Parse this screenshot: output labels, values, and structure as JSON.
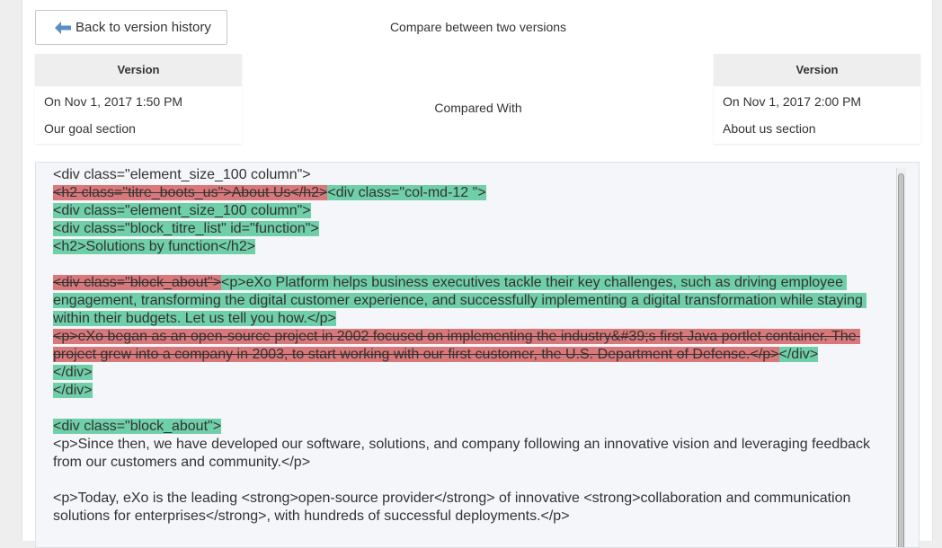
{
  "toolbar": {
    "back_label": "Back to version history"
  },
  "page": {
    "title": "Compare between two versions",
    "compared_with": "Compared With"
  },
  "left_version": {
    "header": "Version",
    "date": "On Nov 1, 2017 1:50 PM",
    "label": "Our goal section"
  },
  "right_version": {
    "header": "Version",
    "date": "On Nov 1, 2017 2:00 PM",
    "label": "About us section"
  },
  "diff": {
    "l1": "<div class=\"element_size_100 column\">",
    "l2_del": "<h2 class=\"titre_boots_us\">About Us</h2>",
    "l2_ins": "<div class=\"col-md-12 \">",
    "l3": "<div class=\"element_size_100 column\">",
    "l4": "<div class=\"block_titre_list\" id=\"function\">",
    "l5": "<h2>Solutions by function</h2>",
    "l6_del": "<div class=\"block_about\">",
    "l6_ins": "<p>eXo Platform helps business executives tackle their key challenges, such as driving employee engagement, transforming the digital customer experience, and successfully implementing a digital transformation while staying within their budgets. Let us tell you how.</p>",
    "l7_del": "<p>eXo began as an open-source project in 2002 focused on implementing the industry&#39;s first Java portlet container. The project grew into a company in 2003, to start working with our first customer, the U.S. Department of Defense.</p>",
    "l7_ins": "</div>",
    "l8": "</div>",
    "l9": "</div>",
    "l10": "<div class=\"block_about\">",
    "l11": "<p>Since then, we have developed our software, solutions, and company following an innovative vision and leveraging feedback from our customers and community.</p>",
    "l12": "<p>Today, eXo is the leading <strong>open-source provider</strong> of innovative <strong>collaboration and communication solutions for enterprises</strong>, with hundreds of successful deployments.</p>"
  },
  "colors": {
    "deleted": "#d9787b",
    "inserted": "#6fcfa9",
    "arrow": "#5b8fc4"
  },
  "icons": {
    "back": "arrow-left-icon"
  }
}
